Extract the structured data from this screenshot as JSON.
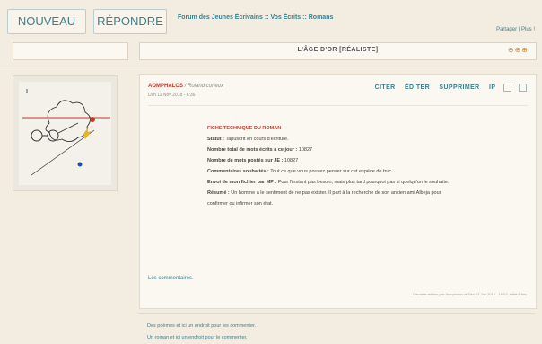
{
  "toolbar": {
    "new_label": "NOUVEAU",
    "reply_label": "RÉPONDRE",
    "breadcrumb": "Forum des Jeunes Écrivains :: Vos Écrits :: Romans",
    "share": "Partager | Plus !"
  },
  "topic": {
    "title": "L'ÂGE D'OR [RÉALISTE]",
    "icons": "⊕⊕⊕"
  },
  "post": {
    "author": "AOMPHALOS",
    "author_rank": " / Roland curieux",
    "date": "Dim 11 Nov 2018 - 6:36",
    "actions": [
      "CITER",
      "ÉDITER",
      "SUPPRIMER",
      "IP"
    ],
    "fiche": {
      "title": "FICHE TECHNIQUE DU ROMAN",
      "statut_label": "Statut : ",
      "statut_value": "Tapuscrit en cours d'écriture.",
      "mots_total_label": "Nombre total de mots écrits à ce jour : ",
      "mots_total_value": "10827",
      "mots_postes_label": "Nombre de mots postés sur JE : ",
      "mots_postes_value": "10827",
      "commentaires_label": "Commentaires souhaités : ",
      "commentaires_value": "Tout ce que vous pouvez penser sur cet espèce de truc.",
      "envoi_label": "Envoi de mon fichier par MP : ",
      "envoi_value": "Pour l'instant pas besoin, mais plus tard pourquoi pas si quelqu'un le souhaite.",
      "resume_label": "Résumé : ",
      "resume_value": "Un homme a le sentiment de ne pas exister. Il part à la recherche de son ancien ami Albeja pour confirmer ou infirmer son état."
    },
    "comments_link": "Les commentaires.",
    "edit_note": "Dernière édition par Aomphalos le Dim 13 Jan 2019 - 16:02, édité 6 fois"
  },
  "footer": {
    "link1": "Des poèmes et ici un endroit pour les commenter.",
    "link2": "Un roman et ici un endroit pour le commenter."
  }
}
